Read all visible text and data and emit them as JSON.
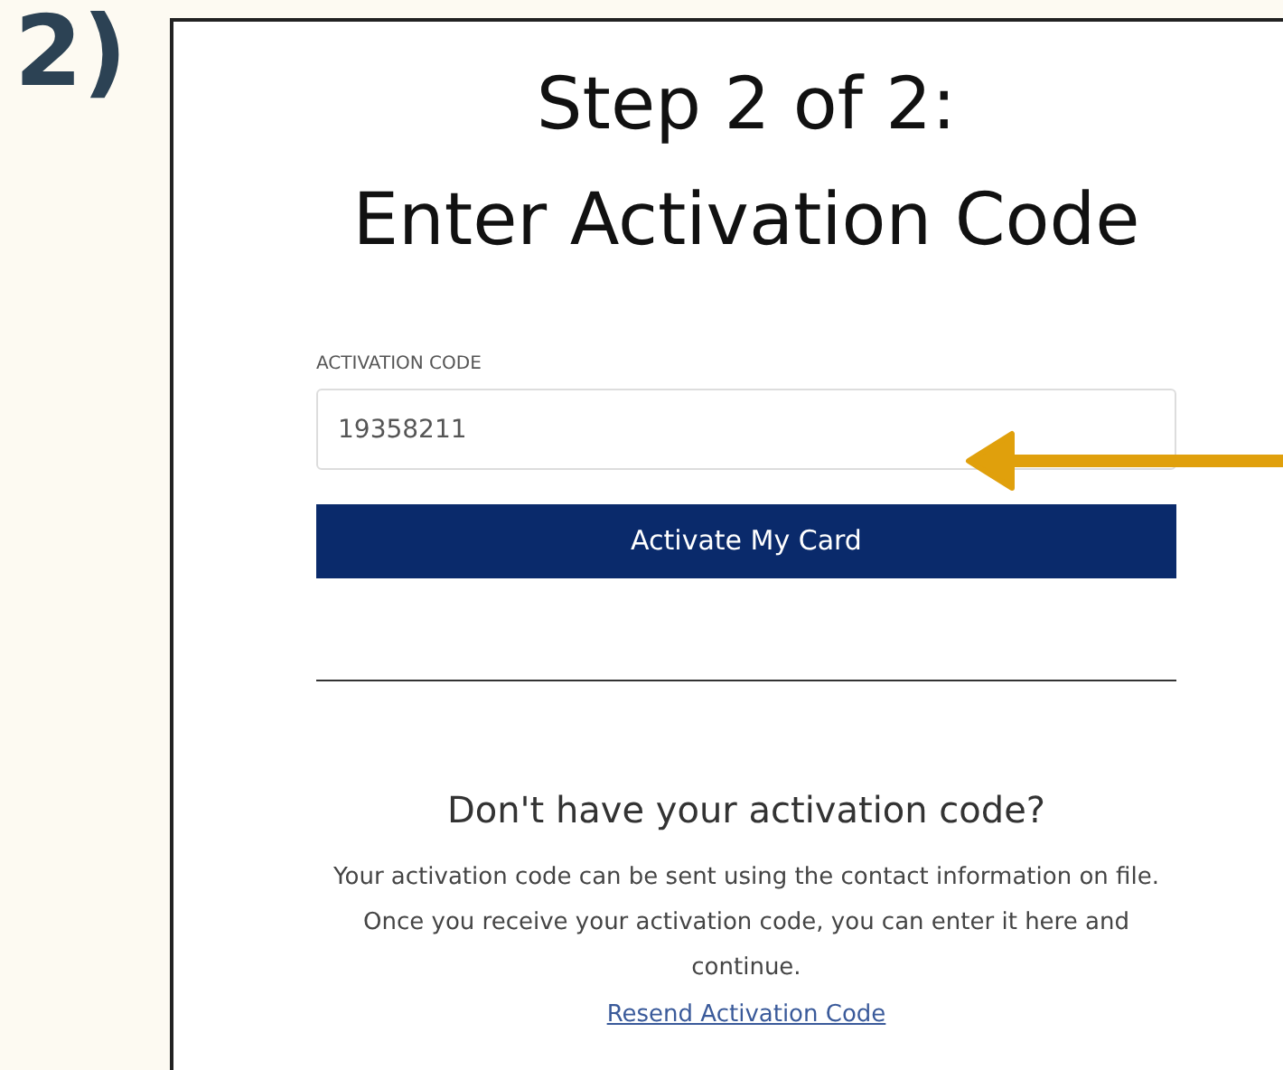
{
  "step_number": "2)",
  "title_lines": [
    "Step 2 of 2:",
    "Enter Activation Code"
  ],
  "activation_field": {
    "label": "ACTIVATION CODE",
    "value": "19358211"
  },
  "activate_button": {
    "label": "Activate My Card"
  },
  "help": {
    "heading": "Don't have your activation code?",
    "text": "Your activation code can be sent using the contact information on file. Once you receive your activation code, you can enter it here and continue.",
    "link": "Resend Activation Code"
  }
}
